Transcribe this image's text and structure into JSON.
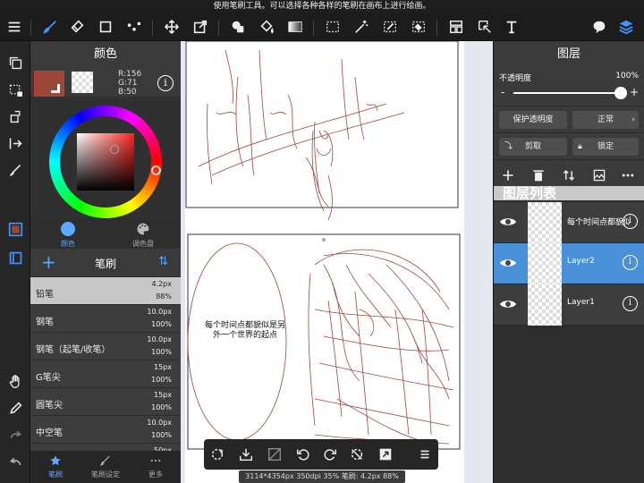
{
  "hint_bar": {
    "text": "使用笔刷工具。可以选择各种各样的笔刷在画布上进行绘画。"
  },
  "color_panel": {
    "title": "颜色",
    "rgb": {
      "r": "R:156",
      "g": "G:71",
      "b": "B:50"
    },
    "current_color": "#9c4732",
    "tabs": [
      {
        "label": "颜色"
      },
      {
        "label": "调色盘"
      }
    ]
  },
  "brush_panel": {
    "title": "笔刷",
    "items": [
      {
        "name": "铅笔",
        "size": "4.2px",
        "opacity": "88%",
        "selected": true
      },
      {
        "name": "钢笔",
        "size": "10.0px",
        "opacity": "100%"
      },
      {
        "name": "钢笔（起笔/收笔）",
        "size": "10.0px",
        "opacity": "100%"
      },
      {
        "name": "G笔尖",
        "size": "15px",
        "opacity": "100%"
      },
      {
        "name": "圆笔尖",
        "size": "15px",
        "opacity": "100%"
      },
      {
        "name": "中空笔",
        "size": "10.0px",
        "opacity": "100%"
      },
      {
        "name": "",
        "size": "50px",
        "opacity": ""
      }
    ]
  },
  "bottom_tabs": [
    {
      "label": "笔刷"
    },
    {
      "label": "笔刷设定"
    },
    {
      "label": "更多"
    }
  ],
  "canvas": {
    "bubble_text": "每个时间点都貌似是另外一个世界的起点",
    "status": "3114*4354px 350dpi 35% 笔刷: 4.2px 88%"
  },
  "layer_panel": {
    "title": "图层",
    "opacity_label": "不透明度",
    "opacity_value": "100%",
    "opacity_level": 1.0,
    "protect_alpha": "保护透明度",
    "blend_mode": "正常",
    "clip": "剪取",
    "lock": "锁定",
    "list_title": "图层列表",
    "layers": [
      {
        "name": "每个时间点都貌似是",
        "selected": false
      },
      {
        "name": "Layer2",
        "selected": true
      },
      {
        "name": "Layer1",
        "selected": false
      }
    ]
  },
  "colors": {
    "accent": "#3e95ff",
    "selected_layer": "#4a90d9",
    "sketch": "#a0453a"
  }
}
